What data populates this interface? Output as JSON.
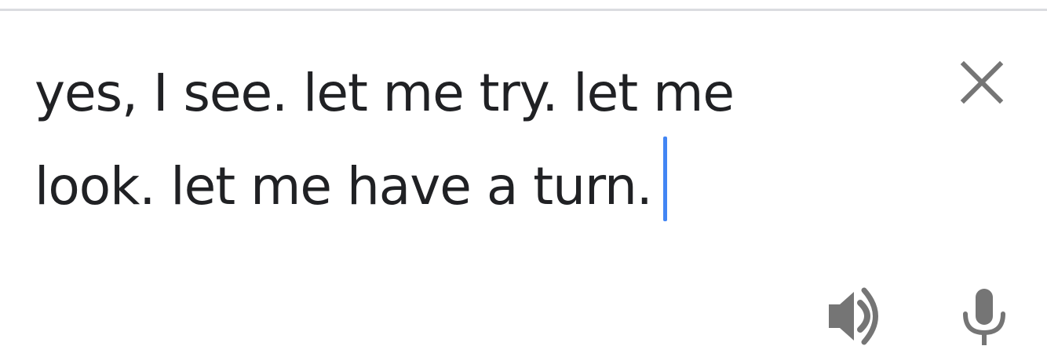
{
  "input": {
    "text": "yes, I see. let me try. let me\nlook. let me have a turn.",
    "caret_color": "#4285f4",
    "text_color": "#202124"
  },
  "toolbar": {
    "close_icon": "close-icon",
    "speaker_icon": "speaker-icon",
    "mic_icon": "mic-icon",
    "icon_color": "#757575"
  },
  "divider_color": "#dadce0"
}
